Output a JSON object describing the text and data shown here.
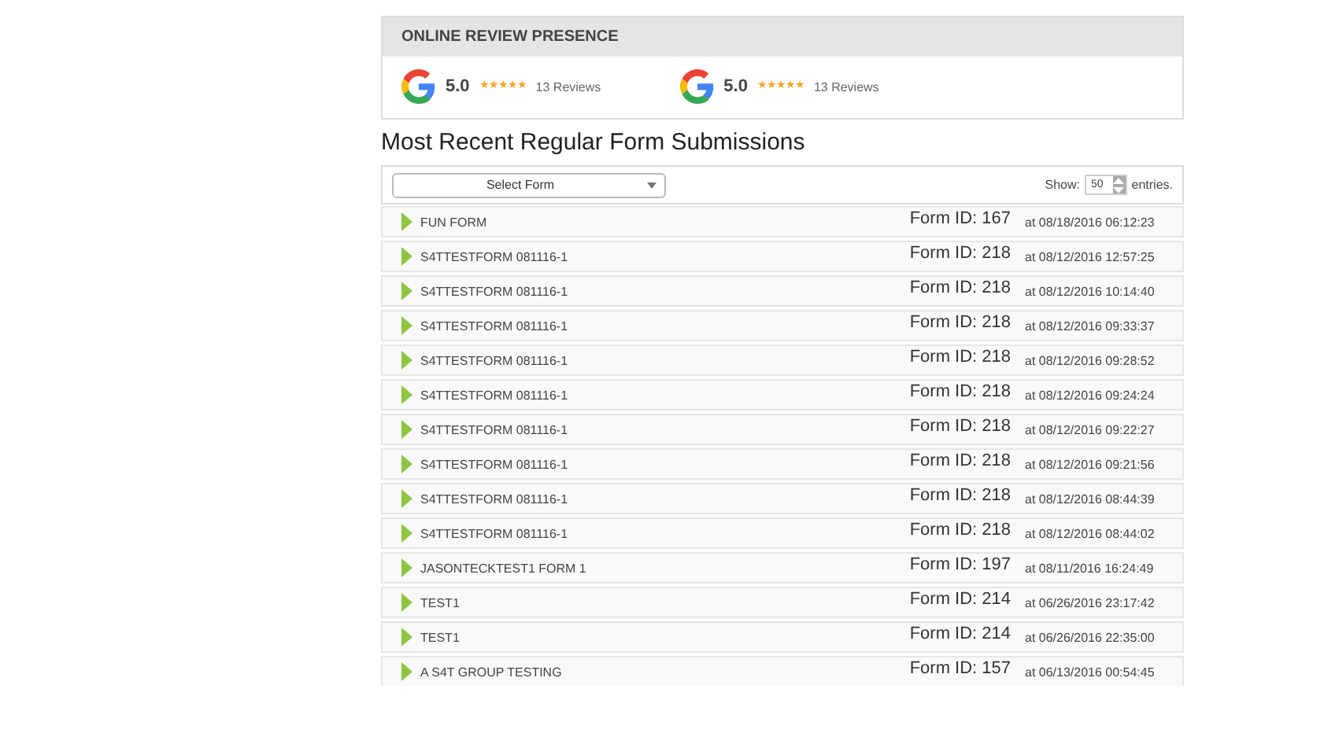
{
  "review_panel": {
    "title": "ONLINE REVIEW PRESENCE",
    "reviews": [
      {
        "score": "5.0",
        "stars": 5,
        "count": "13 Reviews"
      },
      {
        "score": "5.0",
        "stars": 5,
        "count": "13 Reviews"
      }
    ]
  },
  "submissions": {
    "title": "Most Recent Regular Form Submissions",
    "form_select": {
      "value": "Select Form"
    },
    "show_label": "Show:",
    "entries_value": "50",
    "entries_label": "entries.",
    "rows": [
      {
        "name": "FUN FORM",
        "form_id": "Form ID: 167",
        "time": "at 08/18/2016 06:12:23"
      },
      {
        "name": "S4TTESTFORM 081116-1",
        "form_id": "Form ID: 218",
        "time": "at 08/12/2016 12:57:25"
      },
      {
        "name": "S4TTESTFORM 081116-1",
        "form_id": "Form ID: 218",
        "time": "at 08/12/2016 10:14:40"
      },
      {
        "name": "S4TTESTFORM 081116-1",
        "form_id": "Form ID: 218",
        "time": "at 08/12/2016 09:33:37"
      },
      {
        "name": "S4TTESTFORM 081116-1",
        "form_id": "Form ID: 218",
        "time": "at 08/12/2016 09:28:52"
      },
      {
        "name": "S4TTESTFORM 081116-1",
        "form_id": "Form ID: 218",
        "time": "at 08/12/2016 09:24:24"
      },
      {
        "name": "S4TTESTFORM 081116-1",
        "form_id": "Form ID: 218",
        "time": "at 08/12/2016 09:22:27"
      },
      {
        "name": "S4TTESTFORM 081116-1",
        "form_id": "Form ID: 218",
        "time": "at 08/12/2016 09:21:56"
      },
      {
        "name": "S4TTESTFORM 081116-1",
        "form_id": "Form ID: 218",
        "time": "at 08/12/2016 08:44:39"
      },
      {
        "name": "S4TTESTFORM 081116-1",
        "form_id": "Form ID: 218",
        "time": "at 08/12/2016 08:44:02"
      },
      {
        "name": "JASONTECKTEST1 FORM 1",
        "form_id": "Form ID: 197",
        "time": "at 08/11/2016 16:24:49"
      },
      {
        "name": "TEST1",
        "form_id": "Form ID: 214",
        "time": "at 06/26/2016 23:17:42"
      },
      {
        "name": "TEST1",
        "form_id": "Form ID: 214",
        "time": "at 06/26/2016 22:35:00"
      },
      {
        "name": "A S4T GROUP TESTING",
        "form_id": "Form ID: 157",
        "time": "at 06/13/2016 00:54:45"
      }
    ]
  }
}
